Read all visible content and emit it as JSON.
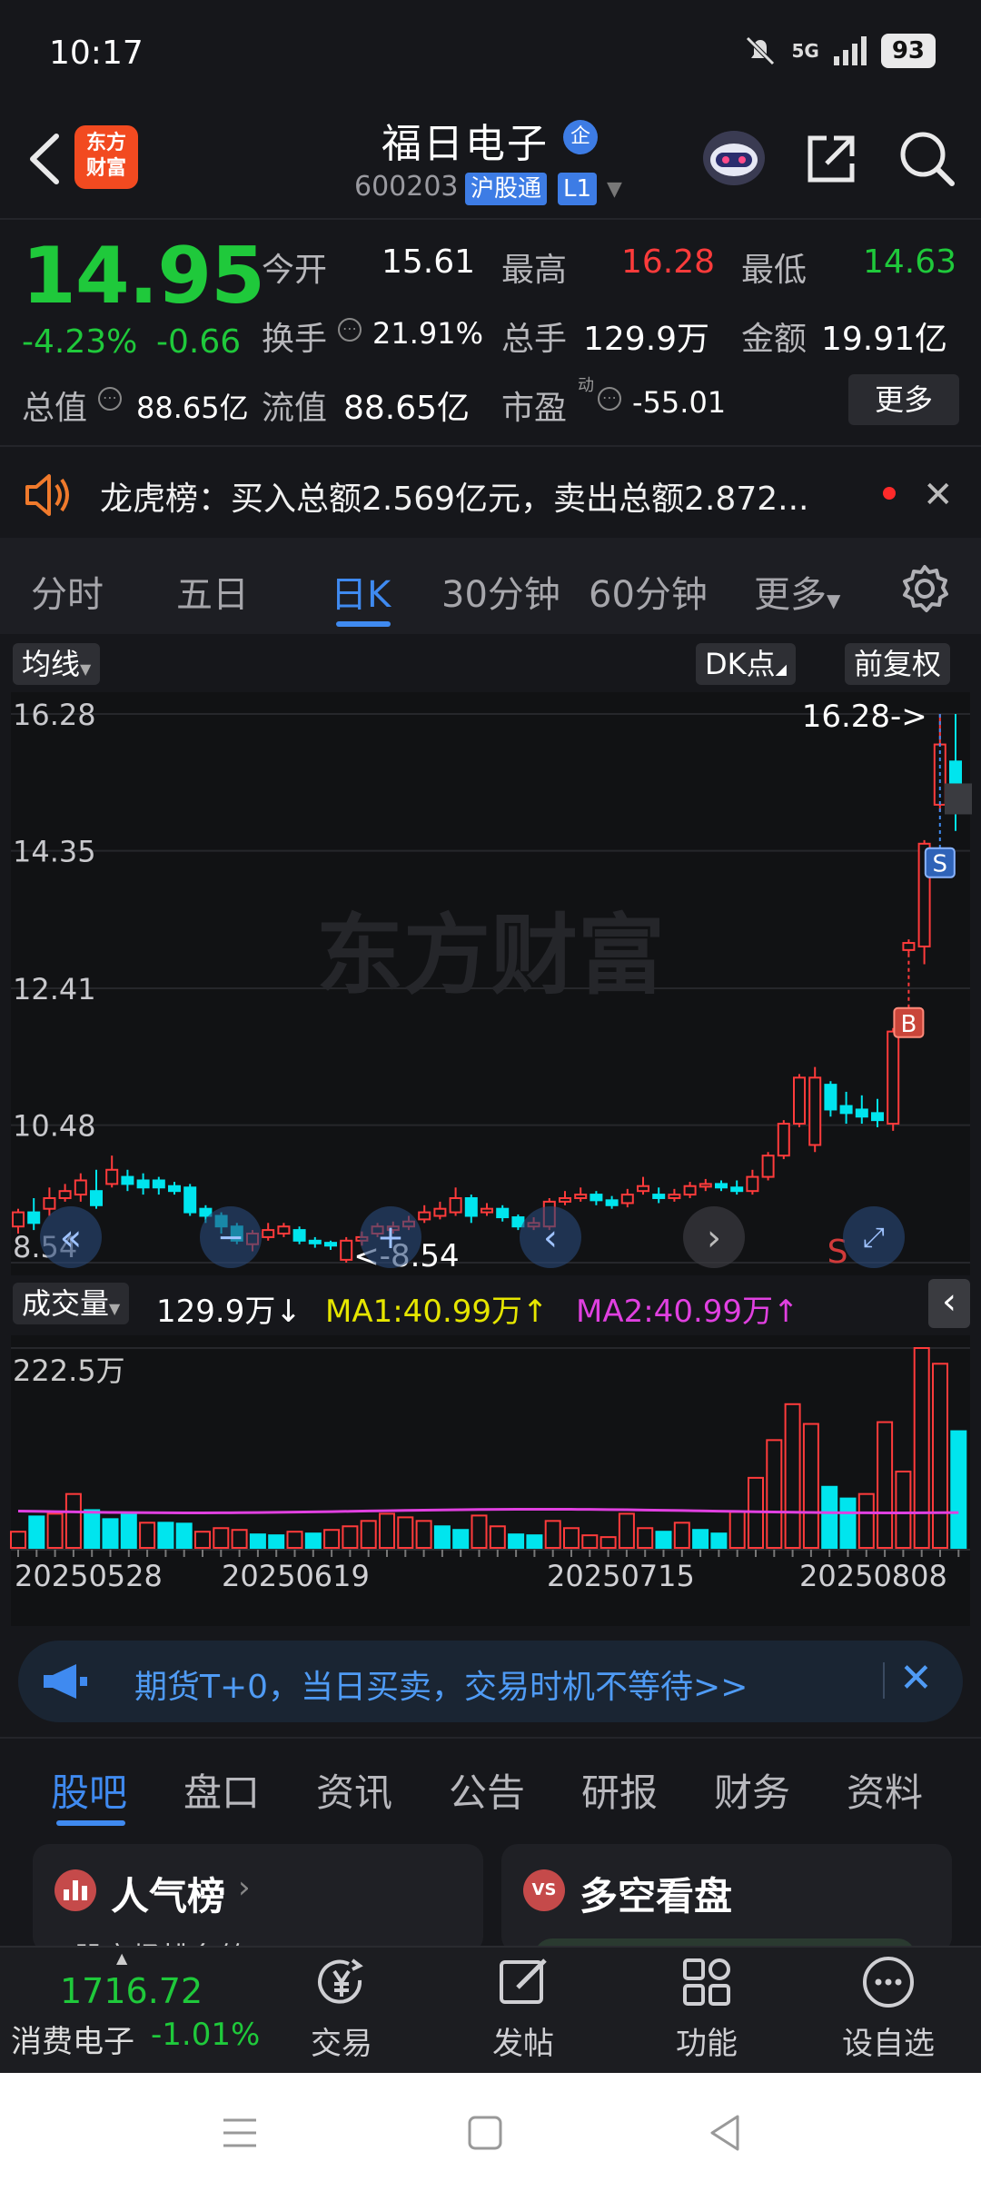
{
  "status_bar": {
    "time": "10:17",
    "network": "5G",
    "battery": "93"
  },
  "header": {
    "logo_text": "东方财富",
    "stock_name": "福日电子",
    "name_badge": "企",
    "stock_code": "600203",
    "connect_badge": "沪股通",
    "level_badge": "L1"
  },
  "quote": {
    "price": "14.95",
    "change_pct": "-4.23%",
    "change": "-0.66",
    "open_label": "今开",
    "open": "15.61",
    "high_label": "最高",
    "high": "16.28",
    "low_label": "最低",
    "low": "14.63",
    "turnover_rate_label": "换手",
    "turnover_rate": "21.91%",
    "volume_label": "总手",
    "volume": "129.9万",
    "amount_label": "金额",
    "amount": "19.91亿",
    "total_mv_label": "总值",
    "total_mv": "88.65亿",
    "float_mv_label": "流值",
    "float_mv": "88.65亿",
    "pe_label": "市盈",
    "pe_sup": "动",
    "pe": "-55.01",
    "more_label": "更多"
  },
  "notice": {
    "text": "龙虎榜：买入总额2.569亿元，卖出总额2.872..."
  },
  "tabs": [
    "分时",
    "五日",
    "日K",
    "30分钟",
    "60分钟",
    "更多"
  ],
  "chart": {
    "ma_selector": "均线",
    "dk_label": "DK点",
    "adjust_label": "前复权",
    "y_ticks": [
      "16.28",
      "14.35",
      "12.41",
      "10.48",
      "8.54"
    ],
    "high_marker": "16.28->",
    "low_marker": "<-8.54",
    "buy_marker": "B",
    "sell_marker": "S",
    "watermark": "东方财富",
    "volume_selector": "成交量",
    "volume_value": "129.9万↓",
    "ma1_text": "MA1:40.99万↑",
    "ma2_text": "MA2:40.99万↑",
    "volume_max_label": "222.5万",
    "date_labels": [
      "20250528",
      "20250619",
      "20250715",
      "20250808"
    ],
    "colors": {
      "up": "#ff3b3b",
      "down": "#00e5ee",
      "ma1": "#e0e000",
      "ma2": "#e040e0"
    }
  },
  "chart_data": {
    "type": "candlestick",
    "ylim": [
      8.54,
      16.28
    ],
    "candles": [
      {
        "o": 9.05,
        "c": 9.25,
        "h": 9.3,
        "l": 8.95
      },
      {
        "o": 9.25,
        "c": 9.1,
        "h": 9.45,
        "l": 9.0
      },
      {
        "o": 9.3,
        "c": 9.45,
        "h": 9.6,
        "l": 9.2
      },
      {
        "o": 9.45,
        "c": 9.55,
        "h": 9.65,
        "l": 9.4
      },
      {
        "o": 9.5,
        "c": 9.7,
        "h": 9.8,
        "l": 9.4
      },
      {
        "o": 9.55,
        "c": 9.35,
        "h": 9.85,
        "l": 9.3
      },
      {
        "o": 9.65,
        "c": 9.85,
        "h": 10.05,
        "l": 9.6
      },
      {
        "o": 9.75,
        "c": 9.65,
        "h": 9.85,
        "l": 9.55
      },
      {
        "o": 9.7,
        "c": 9.6,
        "h": 9.8,
        "l": 9.5
      },
      {
        "o": 9.7,
        "c": 9.6,
        "h": 9.75,
        "l": 9.5
      },
      {
        "o": 9.62,
        "c": 9.55,
        "h": 9.68,
        "l": 9.5
      },
      {
        "o": 9.6,
        "c": 9.25,
        "h": 9.65,
        "l": 9.2
      },
      {
        "o": 9.3,
        "c": 9.2,
        "h": 9.35,
        "l": 9.1
      },
      {
        "o": 9.2,
        "c": 9.05,
        "h": 9.25,
        "l": 8.95
      },
      {
        "o": 9.05,
        "c": 8.85,
        "h": 9.1,
        "l": 8.8
      },
      {
        "o": 8.8,
        "c": 8.95,
        "h": 9.0,
        "l": 8.7
      },
      {
        "o": 8.9,
        "c": 9.0,
        "h": 9.1,
        "l": 8.85
      },
      {
        "o": 8.95,
        "c": 9.05,
        "h": 9.1,
        "l": 8.9
      },
      {
        "o": 9.0,
        "c": 8.85,
        "h": 9.05,
        "l": 8.8
      },
      {
        "o": 8.85,
        "c": 8.82,
        "h": 8.9,
        "l": 8.75
      },
      {
        "o": 8.82,
        "c": 8.78,
        "h": 8.85,
        "l": 8.72
      },
      {
        "o": 8.58,
        "c": 8.85,
        "h": 8.9,
        "l": 8.54
      },
      {
        "o": 8.85,
        "c": 8.9,
        "h": 8.98,
        "l": 8.78
      },
      {
        "o": 8.95,
        "c": 9.05,
        "h": 9.1,
        "l": 8.9
      },
      {
        "o": 9.0,
        "c": 9.05,
        "h": 9.12,
        "l": 8.95
      },
      {
        "o": 9.05,
        "c": 9.12,
        "h": 9.2,
        "l": 9.0
      },
      {
        "o": 9.15,
        "c": 9.25,
        "h": 9.35,
        "l": 9.1
      },
      {
        "o": 9.2,
        "c": 9.3,
        "h": 9.4,
        "l": 9.15
      },
      {
        "o": 9.25,
        "c": 9.45,
        "h": 9.6,
        "l": 9.2
      },
      {
        "o": 9.45,
        "c": 9.2,
        "h": 9.5,
        "l": 9.1
      },
      {
        "o": 9.25,
        "c": 9.3,
        "h": 9.38,
        "l": 9.2
      },
      {
        "o": 9.3,
        "c": 9.18,
        "h": 9.35,
        "l": 9.12
      },
      {
        "o": 9.18,
        "c": 9.05,
        "h": 9.22,
        "l": 9.0
      },
      {
        "o": 9.05,
        "c": 9.1,
        "h": 9.18,
        "l": 9.0
      },
      {
        "o": 9.05,
        "c": 9.4,
        "h": 9.45,
        "l": 9.0
      },
      {
        "o": 9.4,
        "c": 9.45,
        "h": 9.55,
        "l": 9.35
      },
      {
        "o": 9.45,
        "c": 9.5,
        "h": 9.6,
        "l": 9.4
      },
      {
        "o": 9.5,
        "c": 9.42,
        "h": 9.55,
        "l": 9.35
      },
      {
        "o": 9.42,
        "c": 9.35,
        "h": 9.48,
        "l": 9.3
      },
      {
        "o": 9.38,
        "c": 9.5,
        "h": 9.58,
        "l": 9.32
      },
      {
        "o": 9.55,
        "c": 9.62,
        "h": 9.75,
        "l": 9.5
      },
      {
        "o": 9.5,
        "c": 9.45,
        "h": 9.6,
        "l": 9.38
      },
      {
        "o": 9.45,
        "c": 9.5,
        "h": 9.58,
        "l": 9.4
      },
      {
        "o": 9.5,
        "c": 9.62,
        "h": 9.68,
        "l": 9.45
      },
      {
        "o": 9.62,
        "c": 9.65,
        "h": 9.72,
        "l": 9.55
      },
      {
        "o": 9.65,
        "c": 9.6,
        "h": 9.7,
        "l": 9.55
      },
      {
        "o": 9.6,
        "c": 9.55,
        "h": 9.7,
        "l": 9.5
      },
      {
        "o": 9.55,
        "c": 9.75,
        "h": 9.85,
        "l": 9.5
      },
      {
        "o": 9.75,
        "c": 10.05,
        "h": 10.1,
        "l": 9.7
      },
      {
        "o": 10.05,
        "c": 10.5,
        "h": 10.55,
        "l": 10.0
      },
      {
        "o": 10.5,
        "c": 11.15,
        "h": 11.2,
        "l": 10.45
      },
      {
        "o": 10.2,
        "c": 11.15,
        "h": 11.3,
        "l": 10.1
      },
      {
        "o": 11.05,
        "c": 10.7,
        "h": 11.1,
        "l": 10.6
      },
      {
        "o": 10.75,
        "c": 10.65,
        "h": 10.95,
        "l": 10.5
      },
      {
        "o": 10.7,
        "c": 10.6,
        "h": 10.9,
        "l": 10.5
      },
      {
        "o": 10.65,
        "c": 10.55,
        "h": 10.85,
        "l": 10.45
      },
      {
        "o": 10.5,
        "c": 11.8,
        "h": 11.85,
        "l": 10.4
      },
      {
        "o": 12.95,
        "c": 13.05,
        "h": 13.1,
        "l": 12.9
      },
      {
        "o": 13.0,
        "c": 14.45,
        "h": 14.5,
        "l": 12.75
      },
      {
        "o": 15.0,
        "c": 15.85,
        "h": 16.28,
        "l": 14.9
      },
      {
        "o": 15.61,
        "c": 14.95,
        "h": 16.28,
        "l": 14.63
      }
    ],
    "volume_max": 222.5,
    "volume_unit": "万",
    "volumes": [
      {
        "v": 18,
        "up": true
      },
      {
        "v": 35,
        "up": false
      },
      {
        "v": 38,
        "up": true
      },
      {
        "v": 60,
        "up": true
      },
      {
        "v": 42,
        "up": false
      },
      {
        "v": 32,
        "up": false
      },
      {
        "v": 38,
        "up": false
      },
      {
        "v": 28,
        "up": true
      },
      {
        "v": 28,
        "up": false
      },
      {
        "v": 27,
        "up": false
      },
      {
        "v": 18,
        "up": true
      },
      {
        "v": 22,
        "up": true
      },
      {
        "v": 20,
        "up": true
      },
      {
        "v": 15,
        "up": false
      },
      {
        "v": 14,
        "up": false
      },
      {
        "v": 18,
        "up": true
      },
      {
        "v": 16,
        "up": false
      },
      {
        "v": 20,
        "up": true
      },
      {
        "v": 24,
        "up": true
      },
      {
        "v": 30,
        "up": true
      },
      {
        "v": 38,
        "up": true
      },
      {
        "v": 34,
        "up": true
      },
      {
        "v": 30,
        "up": true
      },
      {
        "v": 24,
        "up": false
      },
      {
        "v": 20,
        "up": false
      },
      {
        "v": 36,
        "up": true
      },
      {
        "v": 24,
        "up": true
      },
      {
        "v": 15,
        "up": false
      },
      {
        "v": 14,
        "up": false
      },
      {
        "v": 30,
        "up": true
      },
      {
        "v": 22,
        "up": true
      },
      {
        "v": 14,
        "up": true
      },
      {
        "v": 12,
        "up": true
      },
      {
        "v": 38,
        "up": true
      },
      {
        "v": 22,
        "up": true
      },
      {
        "v": 18,
        "up": false
      },
      {
        "v": 28,
        "up": true
      },
      {
        "v": 20,
        "up": false
      },
      {
        "v": 16,
        "up": false
      },
      {
        "v": 40,
        "up": true
      },
      {
        "v": 78,
        "up": true
      },
      {
        "v": 120,
        "up": true
      },
      {
        "v": 160,
        "up": true
      },
      {
        "v": 138,
        "up": true
      },
      {
        "v": 68,
        "up": false
      },
      {
        "v": 55,
        "up": false
      },
      {
        "v": 60,
        "up": true
      },
      {
        "v": 140,
        "up": true
      },
      {
        "v": 85,
        "up": true
      },
      {
        "v": 222.5,
        "up": true
      },
      {
        "v": 205,
        "up": true
      },
      {
        "v": 129.9,
        "up": false
      }
    ],
    "ma_value": 40.99
  },
  "banner": {
    "text": "期货T+0，当日买卖，交易时机不等待>>"
  },
  "bottom_tabs": [
    "股吧",
    "盘口",
    "资讯",
    "公告",
    "研报",
    "财务",
    "资料"
  ],
  "cards": [
    {
      "icon": "",
      "title": "人气榜",
      "subtitle": "A股市场排名第"
    },
    {
      "icon": "VS",
      "title": "多空看盘"
    }
  ],
  "toolbar": {
    "index_value": "1716.72",
    "index_name": "消费电子",
    "index_pct": "-1.01%",
    "items": [
      "交易",
      "发帖",
      "功能",
      "设自选"
    ]
  }
}
